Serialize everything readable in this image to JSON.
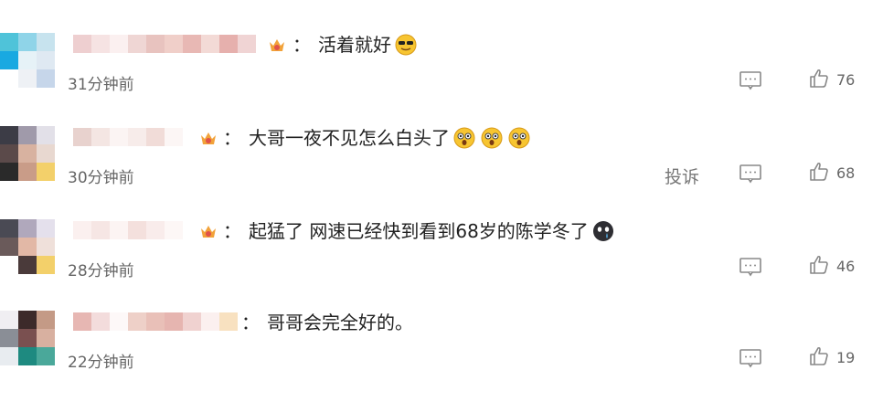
{
  "comments": [
    {
      "text": "活着就好",
      "emojis": [
        "cool-emoji"
      ],
      "time": "31分钟前",
      "likes": "76",
      "report": ""
    },
    {
      "text": "大哥一夜不见怎么白头了",
      "emojis": [
        "shocked-emoji",
        "shocked-emoji",
        "shocked-emoji"
      ],
      "time": "30分钟前",
      "likes": "68",
      "report": "投诉"
    },
    {
      "text": "起猛了 网速已经快到看到68岁的陈学冬了",
      "emojis": [
        "crying-emoji"
      ],
      "time": "28分钟前",
      "likes": "46",
      "report": ""
    },
    {
      "text": "哥哥会完全好的。",
      "emojis": [],
      "time": "22分钟前",
      "likes": "19",
      "report": ""
    }
  ],
  "colon": "：",
  "colors": {
    "crown": "#f2a23a",
    "emoji": "#f7c531",
    "icon": "#888888"
  }
}
